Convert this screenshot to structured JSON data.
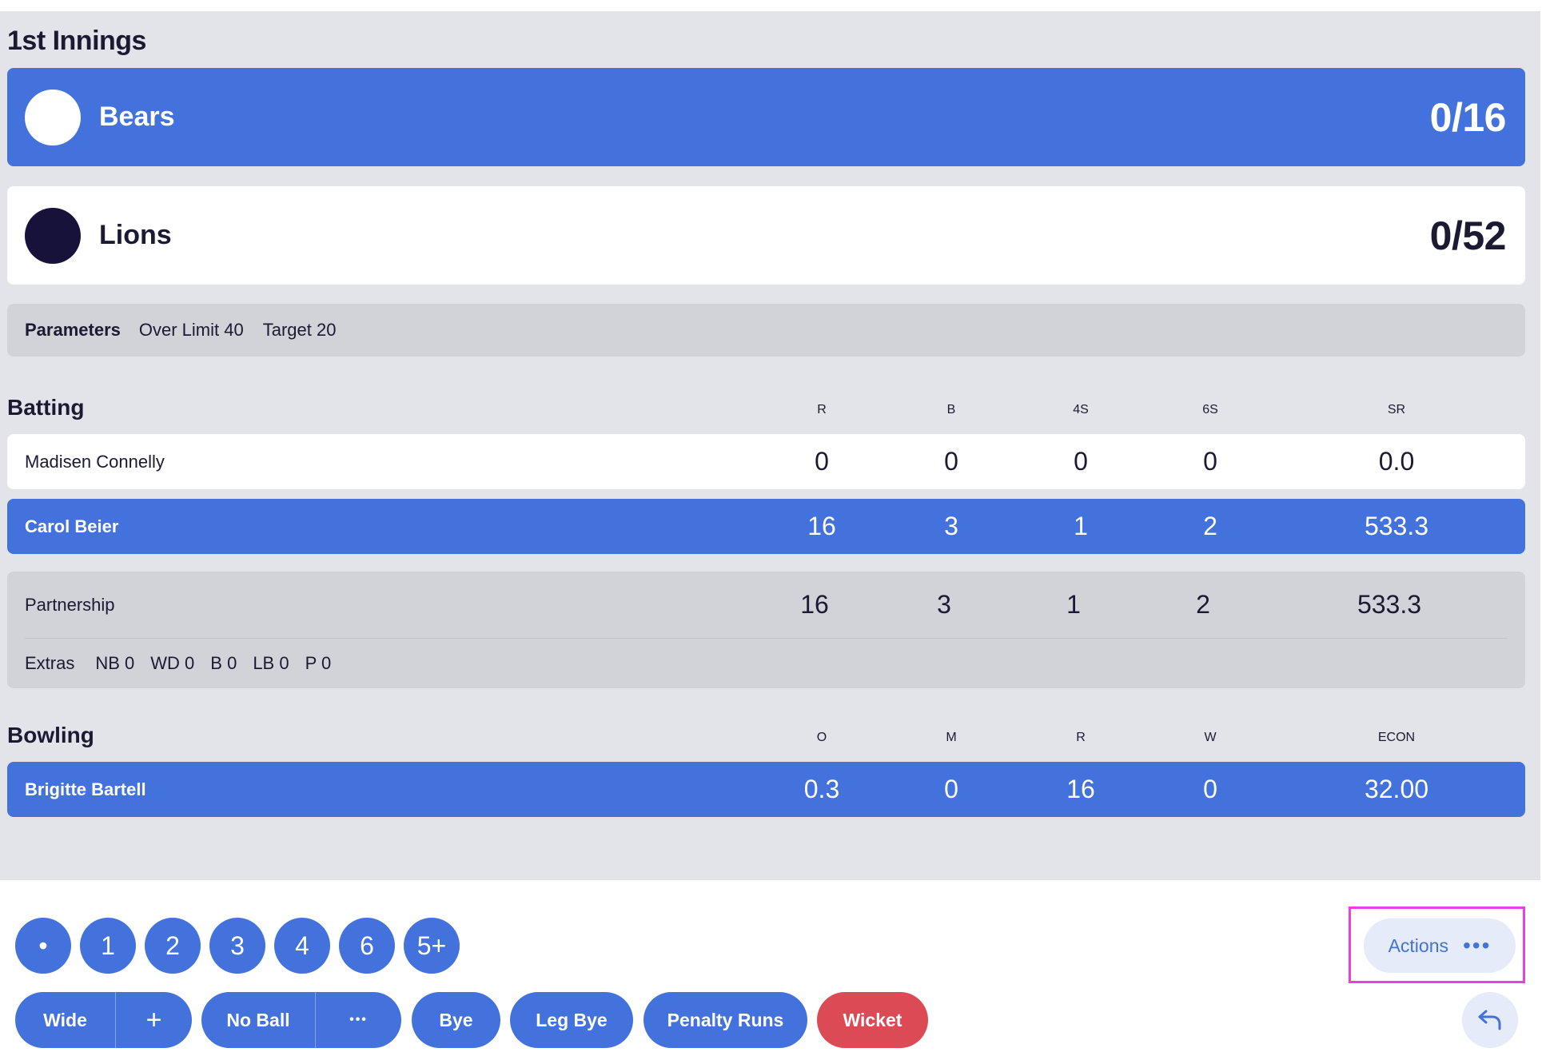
{
  "innings_title": "1st Innings",
  "teams": [
    {
      "name": "Bears",
      "score": "0/16"
    },
    {
      "name": "Lions",
      "score": "0/52"
    }
  ],
  "parameters": {
    "label": "Parameters",
    "over_limit": "Over Limit 40",
    "target": "Target 20"
  },
  "batting": {
    "title": "Batting",
    "headers": [
      "R",
      "B",
      "4S",
      "6S",
      "SR"
    ],
    "rows": [
      {
        "name": "Madisen Connelly",
        "values": [
          "0",
          "0",
          "0",
          "0",
          "0.0"
        ]
      },
      {
        "name": "Carol Beier",
        "values": [
          "16",
          "3",
          "1",
          "2",
          "533.3"
        ]
      }
    ],
    "partnership": {
      "name": "Partnership",
      "values": [
        "16",
        "3",
        "1",
        "2",
        "533.3"
      ]
    },
    "extras": {
      "label": "Extras",
      "items": [
        "NB 0",
        "WD 0",
        "B 0",
        "LB 0",
        "P 0"
      ]
    }
  },
  "bowling": {
    "title": "Bowling",
    "headers": [
      "O",
      "M",
      "R",
      "W",
      "ECON"
    ],
    "rows": [
      {
        "name": "Brigitte Bartell",
        "values": [
          "0.3",
          "0",
          "16",
          "0",
          "32.00"
        ]
      }
    ]
  },
  "controls": {
    "runs": [
      "•",
      "1",
      "2",
      "3",
      "4",
      "6",
      "5+"
    ],
    "wide": {
      "label": "Wide",
      "extra": "+"
    },
    "no_ball": {
      "label": "No Ball",
      "extra": "•••"
    },
    "bye": "Bye",
    "leg_bye": "Leg Bye",
    "penalty_runs": "Penalty Runs",
    "wicket": "Wicket",
    "actions": {
      "label": "Actions",
      "dots": "•••"
    }
  },
  "colors": {
    "accent": "#4472dd",
    "wicket": "#dc4a55",
    "highlight": "#e940e3",
    "dark": "#16123a"
  },
  "icons": {
    "undo": "undo-arrow-icon",
    "more": "more-dots-icon",
    "plus": "plus-icon"
  }
}
